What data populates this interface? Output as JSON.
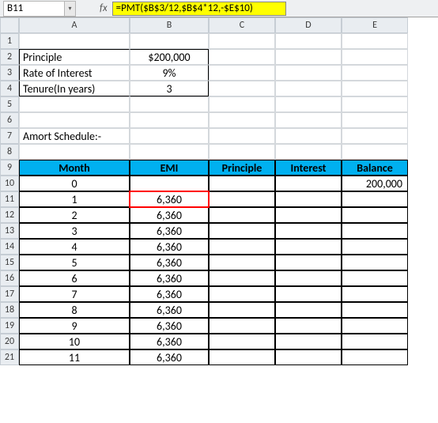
{
  "nameBox": "B11",
  "formula": "=PMT($B$3/12,$B$4*12,-$E$10)",
  "fxLabel": "fx",
  "colHeaders": [
    "A",
    "B",
    "C",
    "D",
    "E"
  ],
  "rowHeaders": [
    "1",
    "2",
    "3",
    "4",
    "5",
    "6",
    "7",
    "8",
    "9",
    "10",
    "11",
    "12",
    "13",
    "14",
    "15",
    "16",
    "17",
    "18",
    "19",
    "20",
    "21"
  ],
  "params": {
    "principleLabel": "Principle",
    "principleValue": "$200,000",
    "rateLabel": "Rate of Interest",
    "rateValue": "9%",
    "tenureLabel": "Tenure(In years)",
    "tenureValue": "3"
  },
  "amortTitle": "Amort Schedule:-",
  "headers": {
    "month": "Month",
    "emi": "EMI",
    "principle": "Principle",
    "interest": "Interest",
    "balance": "Balance"
  },
  "rows": [
    {
      "month": "0",
      "emi": "",
      "principle": "",
      "interest": "",
      "balance": "200,000"
    },
    {
      "month": "1",
      "emi": "6,360",
      "principle": "",
      "interest": "",
      "balance": ""
    },
    {
      "month": "2",
      "emi": "6,360",
      "principle": "",
      "interest": "",
      "balance": ""
    },
    {
      "month": "3",
      "emi": "6,360",
      "principle": "",
      "interest": "",
      "balance": ""
    },
    {
      "month": "4",
      "emi": "6,360",
      "principle": "",
      "interest": "",
      "balance": ""
    },
    {
      "month": "5",
      "emi": "6,360",
      "principle": "",
      "interest": "",
      "balance": ""
    },
    {
      "month": "6",
      "emi": "6,360",
      "principle": "",
      "interest": "",
      "balance": ""
    },
    {
      "month": "7",
      "emi": "6,360",
      "principle": "",
      "interest": "",
      "balance": ""
    },
    {
      "month": "8",
      "emi": "6,360",
      "principle": "",
      "interest": "",
      "balance": ""
    },
    {
      "month": "9",
      "emi": "6,360",
      "principle": "",
      "interest": "",
      "balance": ""
    },
    {
      "month": "10",
      "emi": "6,360",
      "principle": "",
      "interest": "",
      "balance": ""
    },
    {
      "month": "11",
      "emi": "6,360",
      "principle": "",
      "interest": "",
      "balance": ""
    }
  ],
  "chart_data": {
    "type": "table",
    "title": "Amort Schedule",
    "parameters": {
      "Principle": 200000,
      "Rate of Interest": 0.09,
      "Tenure (years)": 3
    },
    "columns": [
      "Month",
      "EMI",
      "Principle",
      "Interest",
      "Balance"
    ],
    "data": [
      [
        0,
        null,
        null,
        null,
        200000
      ],
      [
        1,
        6360,
        null,
        null,
        null
      ],
      [
        2,
        6360,
        null,
        null,
        null
      ],
      [
        3,
        6360,
        null,
        null,
        null
      ],
      [
        4,
        6360,
        null,
        null,
        null
      ],
      [
        5,
        6360,
        null,
        null,
        null
      ],
      [
        6,
        6360,
        null,
        null,
        null
      ],
      [
        7,
        6360,
        null,
        null,
        null
      ],
      [
        8,
        6360,
        null,
        null,
        null
      ],
      [
        9,
        6360,
        null,
        null,
        null
      ],
      [
        10,
        6360,
        null,
        null,
        null
      ],
      [
        11,
        6360,
        null,
        null,
        null
      ]
    ]
  }
}
